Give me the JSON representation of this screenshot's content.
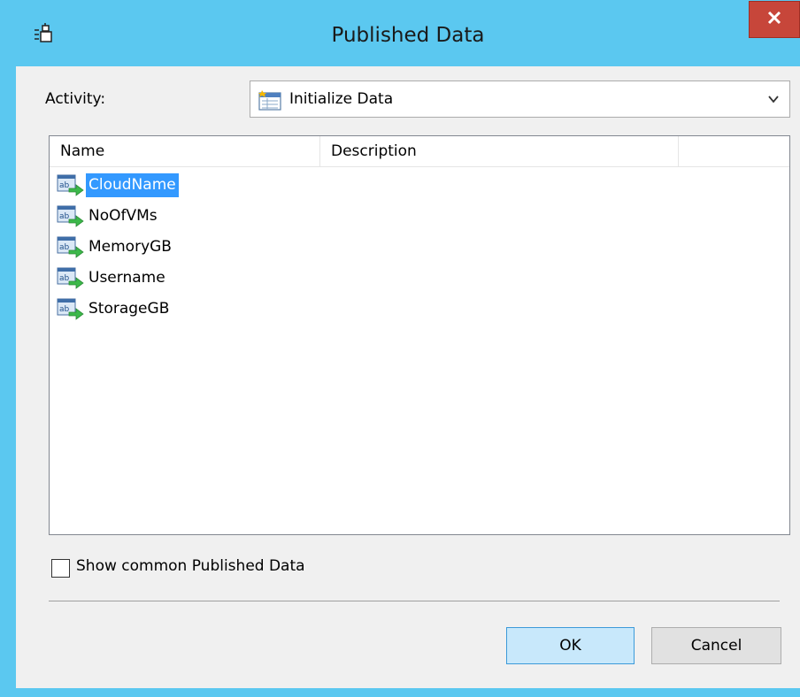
{
  "window": {
    "title": "Published Data",
    "close_symbol": "X",
    "title_icon": "published-data-icon",
    "colors": {
      "frame": "#5bc8f0",
      "close": "#c7463a",
      "selection": "#3399ff"
    }
  },
  "activity": {
    "label": "Activity:",
    "selected": "Initialize Data",
    "icon": "initialize-data-icon"
  },
  "list": {
    "columns": [
      "Name",
      "Description",
      ""
    ],
    "rows": [
      {
        "name": "CloudName",
        "description": "",
        "selected": true
      },
      {
        "name": "NoOfVMs",
        "description": "",
        "selected": false
      },
      {
        "name": "MemoryGB",
        "description": "",
        "selected": false
      },
      {
        "name": "Username",
        "description": "",
        "selected": false
      },
      {
        "name": "StorageGB",
        "description": "",
        "selected": false
      }
    ]
  },
  "options": {
    "show_common_label": "Show common Published Data",
    "show_common_checked": false
  },
  "buttons": {
    "ok": "OK",
    "cancel": "Cancel"
  }
}
